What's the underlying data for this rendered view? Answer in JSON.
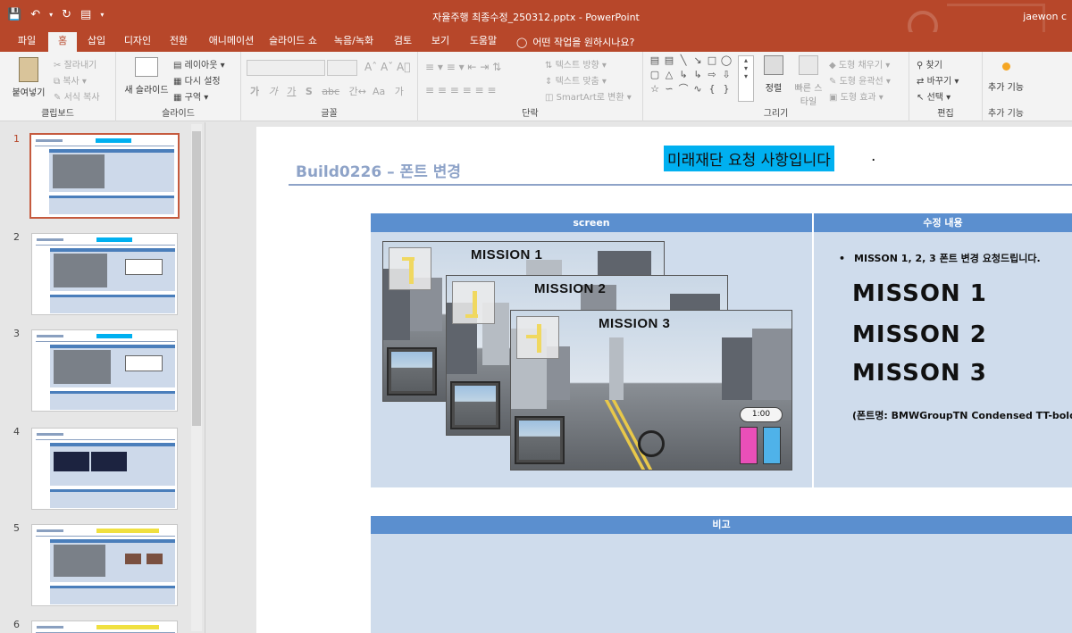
{
  "titlebar": {
    "document_title": "자율주행 최종수정_250312.pptx  -  PowerPoint",
    "user": "jaewon c"
  },
  "tabs": [
    "파일",
    "홈",
    "삽입",
    "디자인",
    "전환",
    "애니메이션",
    "슬라이드 쇼",
    "녹음/녹화",
    "검토",
    "보기",
    "도움말"
  ],
  "active_tab": "홈",
  "tell_me": "어떤 작업을 원하시나요?",
  "ribbon": {
    "clipboard": {
      "paste": "붙여넣기",
      "cut": "잘라내기",
      "copy": "복사",
      "format_painter": "서식 복사",
      "label": "클립보드"
    },
    "slides": {
      "new_slide": "새 슬라이드",
      "layout": "레이아웃",
      "reset": "다시 설정",
      "section": "구역",
      "label": "슬라이드"
    },
    "font": {
      "label": "글꼴",
      "format_buttons": [
        "가",
        "가",
        "가",
        "S",
        "abc",
        "간↔",
        "Aa",
        "가"
      ]
    },
    "paragraph": {
      "text_direction": "텍스트 방향",
      "text_align": "텍스트 맞춤",
      "smartart": "SmartArt로 변환",
      "label": "단락"
    },
    "drawing": {
      "arrange": "정렬",
      "quick_styles": "빠른 스타일",
      "shape_fill": "도형 채우기",
      "shape_outline": "도형 윤곽선",
      "shape_effects": "도형 효과",
      "label": "그리기"
    },
    "editing": {
      "find": "찾기",
      "replace": "바꾸기",
      "select": "선택",
      "label": "편집"
    },
    "addins": {
      "button": "추가 기능",
      "label": "추가 기능"
    }
  },
  "thumbnails": [
    {
      "num": "1"
    },
    {
      "num": "2"
    },
    {
      "num": "3"
    },
    {
      "num": "4"
    },
    {
      "num": "5"
    },
    {
      "num": "6"
    }
  ],
  "slide": {
    "title": "Build0226 – 폰트 변경",
    "highlight": "미래재단 요청 사항입니다",
    "highlight_end": ".",
    "col_screen": "screen",
    "col_changes": "수정 내용",
    "bullet": "MISSON 1, 2, 3 폰트 변경 요청드립니다.",
    "missions": [
      "MISSON 1",
      "MISSON 2",
      "MISSON 3"
    ],
    "font_note": "(폰트명: BMWGroupTN Condensed TT-bold)",
    "remark_header": "비고"
  },
  "screenshots": [
    {
      "label": "MISSION 1"
    },
    {
      "label": "MISSION 2"
    },
    {
      "label": "MISSION 3",
      "timer": "1:00"
    }
  ],
  "colors": {
    "accent": "#b7472a",
    "table_header": "#5b8fcf",
    "table_body": "#cfdcec",
    "highlight": "#00b0f0",
    "title": "#8ea3c8"
  }
}
